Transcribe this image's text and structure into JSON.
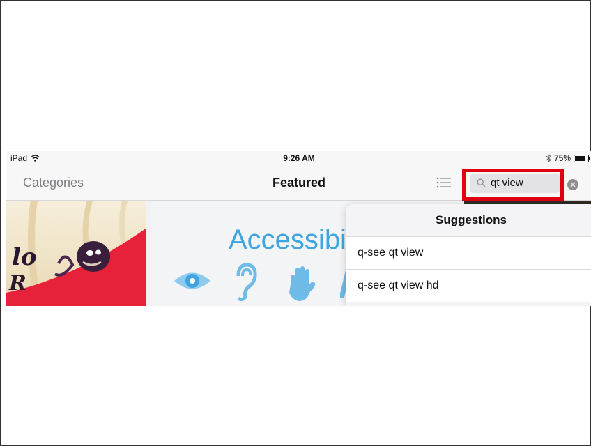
{
  "status_bar": {
    "device": "iPad",
    "time": "9:26 AM",
    "battery": "75%",
    "battery_level": 0.75
  },
  "nav": {
    "left_label": "Categories",
    "title": "Featured",
    "search_value": "qt view"
  },
  "banner": {
    "title": "Accessibil"
  },
  "suggestions": {
    "header": "Suggestions",
    "items": [
      "q-see qt view",
      "q-see qt view hd"
    ]
  },
  "colors": {
    "highlight": "#e00012",
    "accent": "#3fa5e0"
  }
}
